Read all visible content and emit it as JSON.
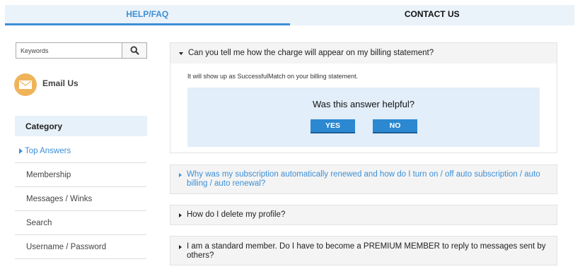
{
  "tabs": {
    "help_label": "HELP/FAQ",
    "contact_label": "CONTACT US"
  },
  "search": {
    "placeholder": "Keywords",
    "icon": "search-icon"
  },
  "email": {
    "label": "Email Us",
    "icon": "envelope-icon",
    "icon_color": "#efb45a"
  },
  "category": {
    "header": "Category",
    "items": [
      {
        "label": "Top Answers",
        "active": true
      },
      {
        "label": "Membership"
      },
      {
        "label": "Messages / Winks"
      },
      {
        "label": "Search"
      },
      {
        "label": "Username / Password"
      }
    ]
  },
  "faqs": [
    {
      "question": "Can you tell me how the charge will appear on my billing statement?",
      "expanded": true,
      "answer": "It will show up as SuccessfulMatch on your billing statement.",
      "helpful": {
        "title": "Was this answer helpful?",
        "yes_label": "YES",
        "no_label": "NO"
      }
    },
    {
      "question": "Why was my subscription automatically renewed and how do I turn on / off auto subscription / auto billing / auto renewal?"
    },
    {
      "question": "How do I delete my profile?"
    },
    {
      "question": "I am a standard member. Do I have to become a PREMIUM MEMBER to reply to messages sent by others?"
    }
  ],
  "colors": {
    "accent": "#3d8fd6",
    "button": "#2b88d1",
    "panel_bg": "#e2eef9"
  }
}
